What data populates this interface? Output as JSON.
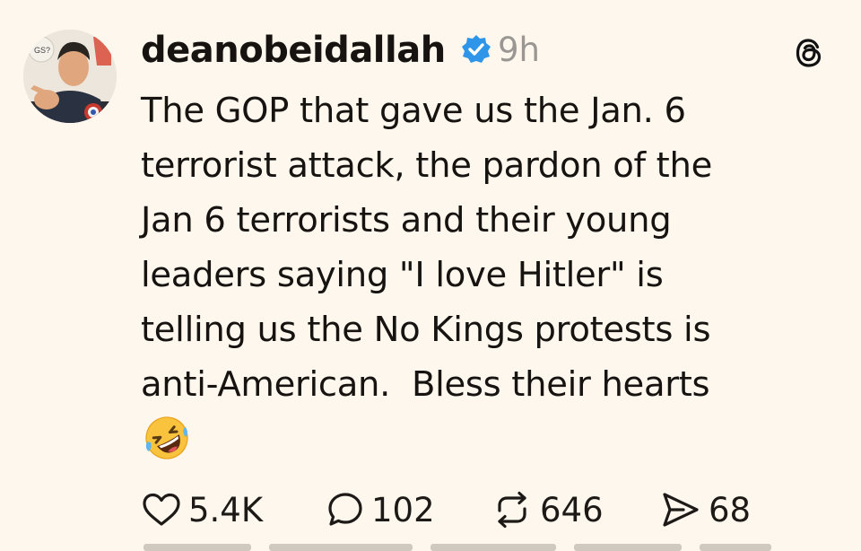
{
  "post": {
    "username": "deanobeidallah",
    "verified_icon": "verified-badge-icon",
    "time_ago": "9h",
    "text_lines": [
      "The GOP that gave us the Jan. 6",
      "terrorist attack, the pardon of the",
      "Jan 6 terrorists and their young",
      "leaders saying \"I love Hitler\" is",
      "telling us the No Kings protests is",
      "anti-American.  Bless their hearts"
    ],
    "emoji": "rolling-on-floor-laughing-emoji"
  },
  "actions": {
    "likes": "5.4K",
    "replies": "102",
    "reposts": "646",
    "shares": "68"
  },
  "colors": {
    "background": "#fdf7ee",
    "text": "#161310",
    "muted": "#9a9792",
    "verified": "#2f95e8"
  }
}
